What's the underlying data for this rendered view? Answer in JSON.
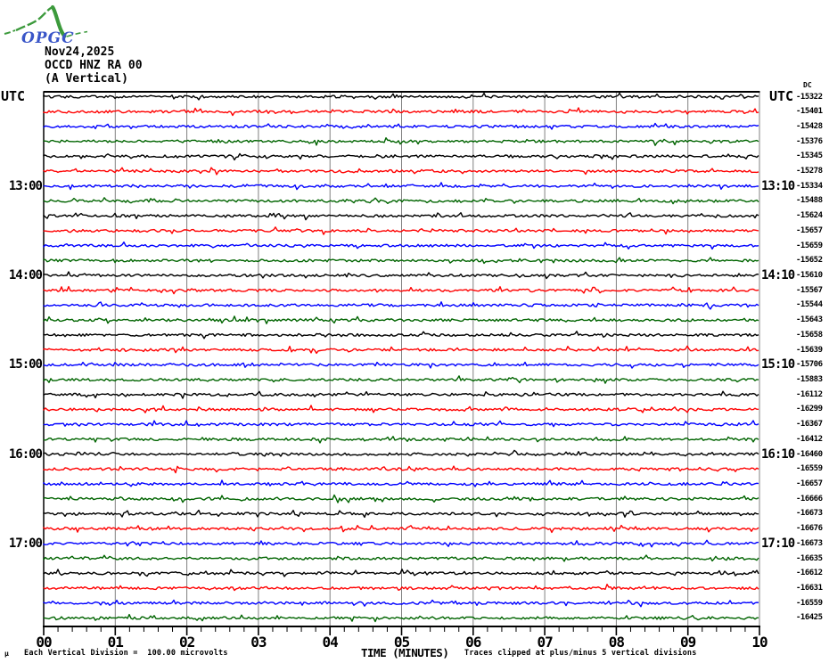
{
  "logo": {
    "text": "OPGC",
    "curve_color": "#3c9a3c",
    "text_color": "#3a56c8"
  },
  "header": {
    "date": "Nov24,2025",
    "station": "OCCD HNZ RA 00",
    "channel": "(A Vertical)"
  },
  "axes": {
    "left_axis_title": "UTC",
    "right_axis_title": "UTC",
    "dc_column_header": "DC",
    "x_axis_title": "TIME (MINUTES)",
    "x_tick_labels": [
      "00",
      "01",
      "02",
      "03",
      "04",
      "05",
      "06",
      "07",
      "08",
      "09",
      "10"
    ]
  },
  "footer": {
    "micro_mark": "µ",
    "scale_note": "Each Vertical Division =  100.00 microvolts",
    "clip_note": "Traces clipped at plus/minus 5 vertical divisions"
  },
  "chart_data": {
    "type": "line",
    "title": "OCCD HNZ RA 00 (A Vertical) webicorder — Nov24,2025",
    "x_label": "TIME (MINUTES)",
    "x_range": [
      0,
      10
    ],
    "minutes_per_row": 10,
    "grid": true,
    "grid_color": "#808080",
    "color_cycle": [
      "#000000",
      "#ff0000",
      "#0000ff",
      "#006400"
    ],
    "rows": [
      {
        "start": "12:00",
        "color": "black",
        "dc": -15322
      },
      {
        "start": "12:10",
        "color": "red",
        "dc": -15401
      },
      {
        "start": "12:20",
        "color": "blue",
        "dc": -15428
      },
      {
        "start": "12:30",
        "color": "green",
        "dc": -15376
      },
      {
        "start": "12:40",
        "color": "black",
        "dc": -15345
      },
      {
        "start": "12:50",
        "color": "red",
        "dc": -15278
      },
      {
        "start": "13:00",
        "color": "blue",
        "dc": -15334
      },
      {
        "start": "13:10",
        "color": "green",
        "dc": -15488
      },
      {
        "start": "13:20",
        "color": "black",
        "dc": -15624
      },
      {
        "start": "13:30",
        "color": "red",
        "dc": -15657
      },
      {
        "start": "13:40",
        "color": "blue",
        "dc": -15659
      },
      {
        "start": "13:50",
        "color": "green",
        "dc": -15652
      },
      {
        "start": "14:00",
        "color": "black",
        "dc": -15610
      },
      {
        "start": "14:10",
        "color": "red",
        "dc": -15567
      },
      {
        "start": "14:20",
        "color": "blue",
        "dc": -15544
      },
      {
        "start": "14:30",
        "color": "green",
        "dc": -15643
      },
      {
        "start": "14:40",
        "color": "black",
        "dc": -15658
      },
      {
        "start": "14:50",
        "color": "red",
        "dc": -15639
      },
      {
        "start": "15:00",
        "color": "blue",
        "dc": -15706
      },
      {
        "start": "15:10",
        "color": "green",
        "dc": -15883
      },
      {
        "start": "15:20",
        "color": "black",
        "dc": -16112
      },
      {
        "start": "15:30",
        "color": "red",
        "dc": -16299
      },
      {
        "start": "15:40",
        "color": "blue",
        "dc": -16367
      },
      {
        "start": "15:50",
        "color": "green",
        "dc": -16412
      },
      {
        "start": "16:00",
        "color": "black",
        "dc": -16460
      },
      {
        "start": "16:10",
        "color": "red",
        "dc": -16559
      },
      {
        "start": "16:20",
        "color": "blue",
        "dc": -16657
      },
      {
        "start": "16:30",
        "color": "green",
        "dc": -16666
      },
      {
        "start": "16:40",
        "color": "black",
        "dc": -16673
      },
      {
        "start": "16:50",
        "color": "red",
        "dc": -16676
      },
      {
        "start": "17:00",
        "color": "blue",
        "dc": -16673
      },
      {
        "start": "17:10",
        "color": "green",
        "dc": -16635
      },
      {
        "start": "17:20",
        "color": "black",
        "dc": -16612
      },
      {
        "start": "17:30",
        "color": "red",
        "dc": -16631
      },
      {
        "start": "17:40",
        "color": "blue",
        "dc": -16559
      },
      {
        "start": "17:50",
        "color": "green",
        "dc": -16425
      }
    ],
    "hour_labels_left": [
      {
        "row": 7,
        "label": "13:00"
      },
      {
        "row": 13,
        "label": "14:00"
      },
      {
        "row": 19,
        "label": "15:00"
      },
      {
        "row": 25,
        "label": "16:00"
      },
      {
        "row": 31,
        "label": "17:00"
      }
    ],
    "hour_labels_right": [
      {
        "row": 7,
        "label": "13:10"
      },
      {
        "row": 13,
        "label": "14:10"
      },
      {
        "row": 19,
        "label": "15:10"
      },
      {
        "row": 25,
        "label": "16:10"
      },
      {
        "row": 31,
        "label": "17:10"
      }
    ]
  }
}
